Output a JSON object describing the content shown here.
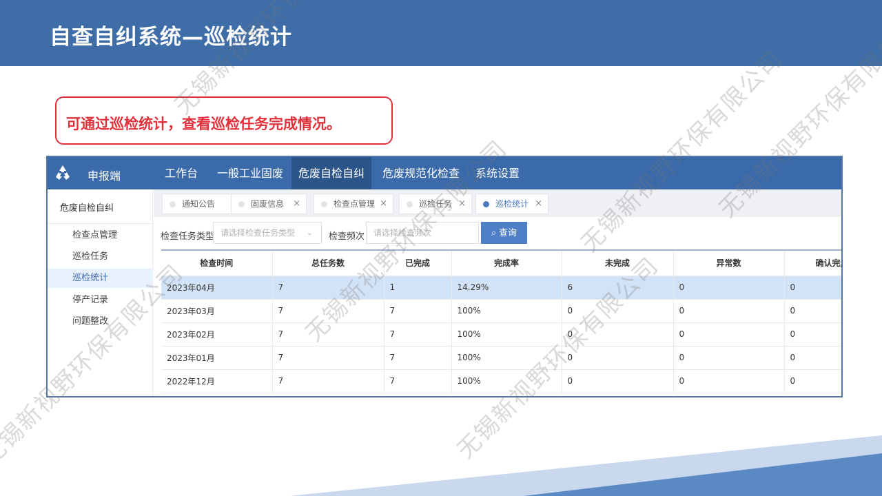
{
  "slide": {
    "title": "自查自纠系统—巡检统计",
    "callout": "可通过巡检统计，查看巡检任务完成情况。",
    "watermark": "无锡新视野环保有限公司"
  },
  "app": {
    "brand": "申报端",
    "nav": [
      "工作台",
      "一般工业固废",
      "危废自检自纠",
      "危废规范化检查",
      "系统设置"
    ],
    "nav_active": "危废自检自纠",
    "sidebar": {
      "title": "危废自检自纠",
      "items": [
        "检查点管理",
        "巡检任务",
        "巡检统计",
        "停产记录",
        "问题整改"
      ],
      "active": "巡检统计"
    },
    "tabs": [
      {
        "label": "通知公告"
      },
      {
        "label": "固废信息"
      },
      {
        "label": "检查点管理"
      },
      {
        "label": "巡检任务"
      },
      {
        "label": "巡检统计"
      }
    ],
    "tab_close": "×",
    "filters": {
      "task_type_label": "检查任务类型",
      "task_type_placeholder": "请选择检查任务类型",
      "freq_label": "检查频次",
      "freq_placeholder": "请选择检查频次",
      "query_label": "查询"
    },
    "table": {
      "columns": [
        "检查时间",
        "总任务数",
        "已完成",
        "完成率",
        "未完成",
        "异常数",
        "确认完成"
      ],
      "rows": [
        [
          "2023年04月",
          "7",
          "1",
          "14.29%",
          "6",
          "0",
          "0"
        ],
        [
          "2023年03月",
          "7",
          "7",
          "100%",
          "0",
          "0",
          "0"
        ],
        [
          "2023年02月",
          "7",
          "7",
          "100%",
          "0",
          "0",
          "0"
        ],
        [
          "2023年01月",
          "7",
          "7",
          "100%",
          "0",
          "0",
          "0"
        ],
        [
          "2022年12月",
          "7",
          "7",
          "100%",
          "0",
          "0",
          "0"
        ]
      ]
    }
  },
  "colors": {
    "header_blue": "#3e6da7",
    "nav_blue": "#3a6aa9",
    "accent_red": "#e0303a",
    "selected_row": "#d3e3f7"
  }
}
